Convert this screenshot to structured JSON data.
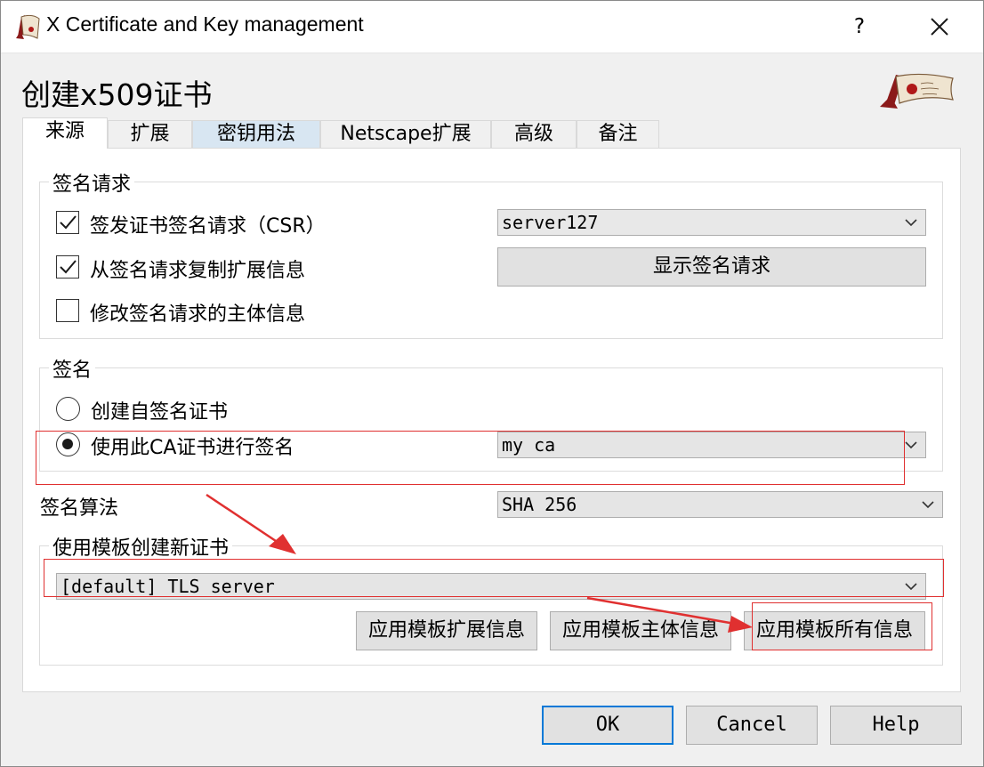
{
  "window": {
    "title": "X Certificate and Key management",
    "help_label": "?"
  },
  "dialog": {
    "heading": "创建x509证书"
  },
  "tabs": [
    {
      "label": "来源"
    },
    {
      "label": "扩展"
    },
    {
      "label": "密钥用法"
    },
    {
      "label": "Netscape扩展"
    },
    {
      "label": "高级"
    },
    {
      "label": "备注"
    }
  ],
  "signing_request": {
    "group_title": "签名请求",
    "sign_csr": {
      "label": "签发证书签名请求（CSR）",
      "checked": true
    },
    "copy_extensions": {
      "label": "从签名请求复制扩展信息",
      "checked": true
    },
    "modify_subject": {
      "label": "修改签名请求的主体信息",
      "checked": false
    },
    "csr_select": {
      "value": "server127"
    },
    "show_request_button": "显示签名请求"
  },
  "signing": {
    "group_title": "签名",
    "self_signed": {
      "label": "创建自签名证书",
      "selected": false
    },
    "use_ca": {
      "label": "使用此CA证书进行签名",
      "selected": true
    },
    "ca_select": {
      "value": "my ca"
    }
  },
  "signature_algorithm": {
    "label": "签名算法",
    "value": "SHA 256"
  },
  "template": {
    "group_title": "使用模板创建新证书",
    "select_value": "[default] TLS_server",
    "apply_extensions_button": "应用模板扩展信息",
    "apply_subject_button": "应用模板主体信息",
    "apply_all_button": "应用模板所有信息"
  },
  "footer": {
    "ok_button": "OK",
    "cancel_button": "Cancel",
    "help_button": "Help"
  },
  "colors": {
    "accent": "#0078d7",
    "annotation": "#e03030",
    "tab_hover": "#d8e6f2"
  }
}
